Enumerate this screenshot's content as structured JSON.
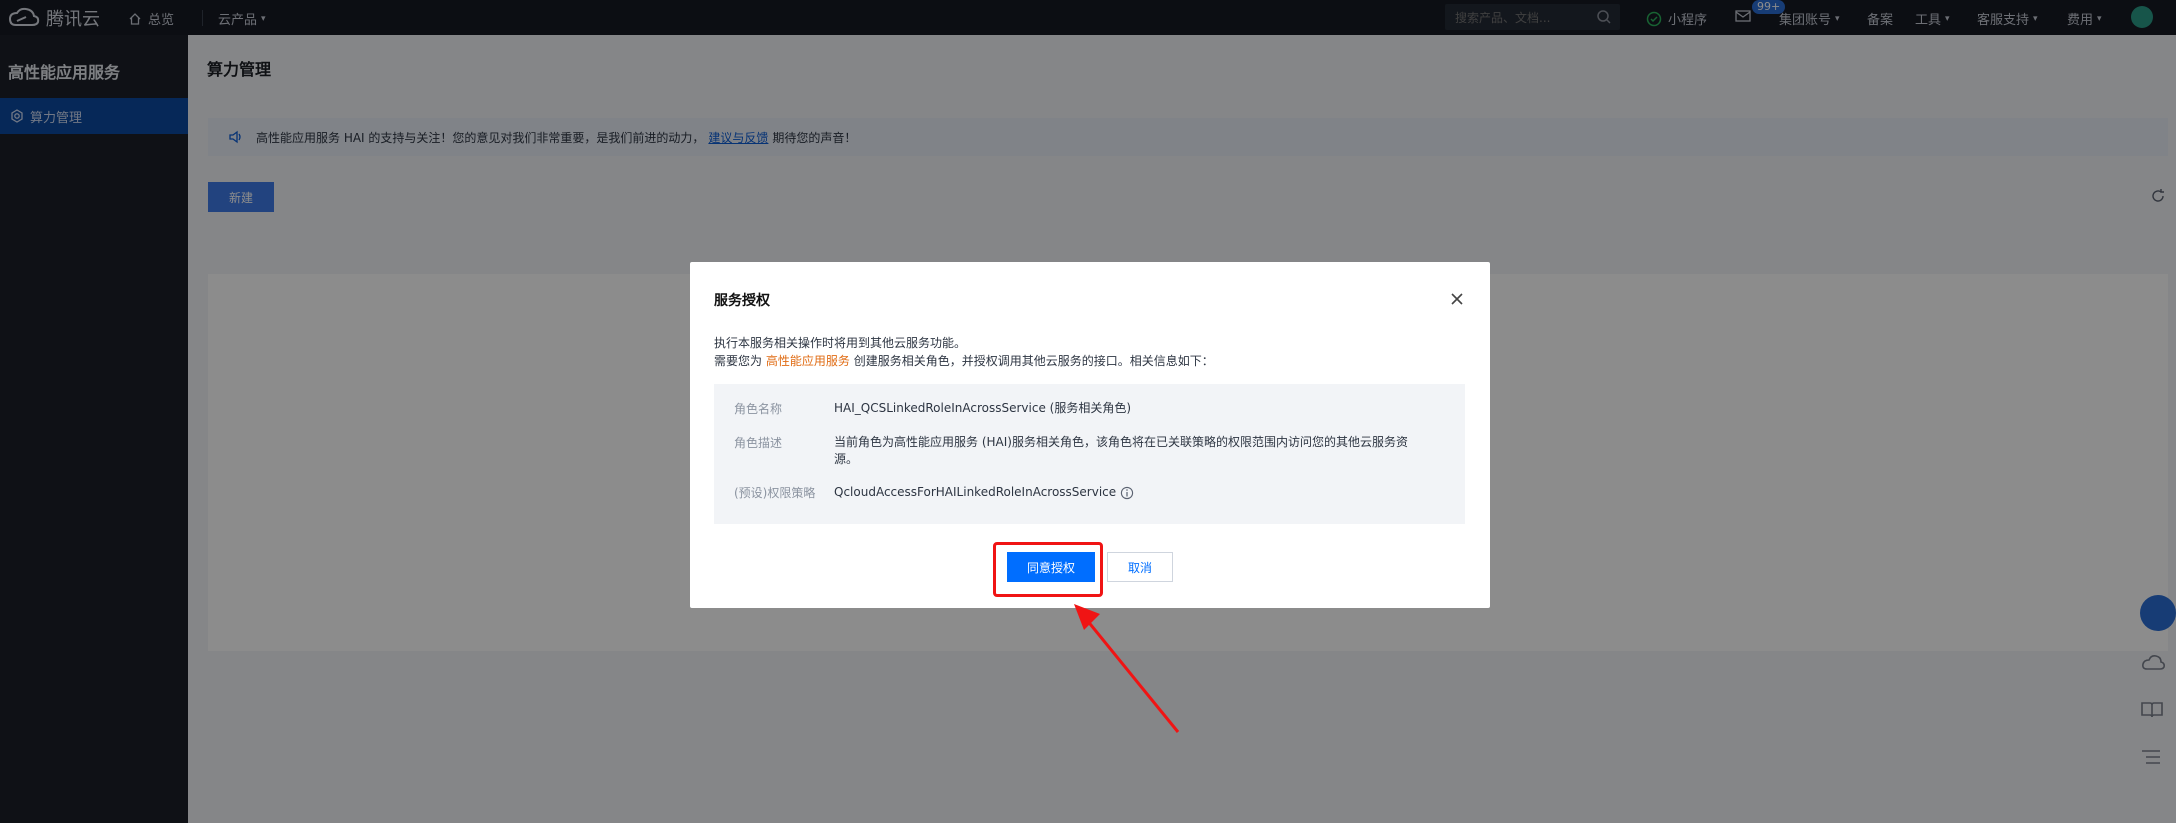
{
  "topbar": {
    "brand": "腾讯云",
    "home_label": "总览",
    "products_label": "云产品",
    "search_placeholder": "搜索产品、文档...",
    "mini_program": "小程序",
    "badge": "99+",
    "group_account": "集团账号",
    "filing": "备案",
    "tools": "工具",
    "support": "客服支持",
    "billing": "费用"
  },
  "sidebar": {
    "title": "高性能应用服务",
    "items": [
      {
        "label": "算力管理"
      }
    ]
  },
  "page": {
    "title": "算力管理",
    "notice_text": "高性能应用服务 HAI 的支持与关注！您的意见对我们非常重要，是我们前进的动力，",
    "notice_link": "建议与反馈",
    "notice_tail": "期待您的声音！",
    "new_button": "新建"
  },
  "modal": {
    "title": "服务授权",
    "desc_line1": "执行本服务相关操作时将用到其他云服务功能。",
    "desc_line2_prefix": "需要您为",
    "desc_line2_highlight": "高性能应用服务",
    "desc_line2_suffix": "创建服务相关角色，并授权调用其他云服务的接口。相关信息如下：",
    "rows": [
      {
        "label": "角色名称",
        "value": "HAI_QCSLinkedRoleInAcrossService (服务相关角色)"
      },
      {
        "label": "角色描述",
        "value": "当前角色为高性能应用服务 (HAI)服务相关角色，该角色将在已关联策略的权限范围内访问您的其他云服务资源。"
      },
      {
        "label": "(预设)权限策略",
        "value": "QcloudAccessForHAILinkedRoleInAcrossService"
      }
    ],
    "confirm_label": "同意授权",
    "cancel_label": "取消"
  },
  "colors": {
    "primary": "#006eff",
    "highlight": "#e06c14",
    "annotation": "#f01414"
  }
}
